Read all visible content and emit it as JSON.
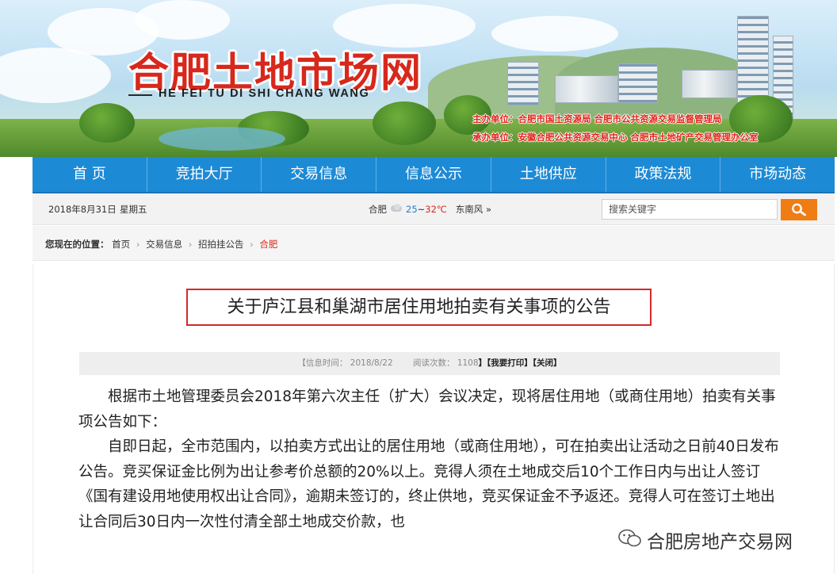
{
  "header": {
    "title": "合肥土地市场网",
    "subtitle": "HE FEI TU DI SHI CHANG WANG",
    "sponsor_line": "主办单位：合肥市国土资源局 合肥市公共资源交易监督管理局",
    "organizer_line": "承办单位：安徽合肥公共资源交易中心 合肥市土地矿产交易管理办公室"
  },
  "nav": {
    "items": [
      "首 页",
      "竞拍大厅",
      "交易信息",
      "信息公示",
      "土地供应",
      "政策法规",
      "市场动态"
    ]
  },
  "infobar": {
    "date": "2018年8月31日",
    "weekday": "星期五",
    "city": "合肥",
    "temp_low": "25",
    "temp_sep": "~",
    "temp_high": "32℃",
    "wind": "东南风",
    "wind_more": "»",
    "search_placeholder": "搜索关键字",
    "icons": {
      "weather": "cloud-icon",
      "search": "search-icon"
    }
  },
  "breadcrumb": {
    "label": "您现在的位置：",
    "items": [
      "首页",
      "交易信息",
      "招拍挂公告",
      "合肥"
    ],
    "separator": "›"
  },
  "article": {
    "title": "关于庐江县和巢湖市居住用地拍卖有关事项的公告",
    "meta_time_label": "【信息时间：",
    "meta_time": "2018/8/22",
    "meta_reads_label": "阅读次数：",
    "meta_reads": "1108",
    "meta_print": "】【我要打印】",
    "meta_close": "【关闭】",
    "paragraphs": [
      "根据市土地管理委员会2018年第六次主任（扩大）会议决定，现将居住用地（或商住用地）拍卖有关事项公告如下：",
      "自即日起，全市范围内，以拍卖方式出让的居住用地（或商住用地），可在拍卖出让活动之日前40日发布公告。竞买保证金比例为出让参考价总额的20%以上。竞得人须在土地成交后10个工作日内与出让人签订《国有建设用地使用权出让合同》，逾期未签订的，终止供地，竞买保证金不予返还。竞得人可在签订土地出让合同后30日内一次性付清全部土地成交价款，也"
    ]
  },
  "watermark": {
    "text": "合肥房地产交易网"
  },
  "colors": {
    "nav_blue": "#1d8ad6",
    "title_red": "#d7281c",
    "search_orange": "#f07c14",
    "title_border": "#d32a2a"
  }
}
